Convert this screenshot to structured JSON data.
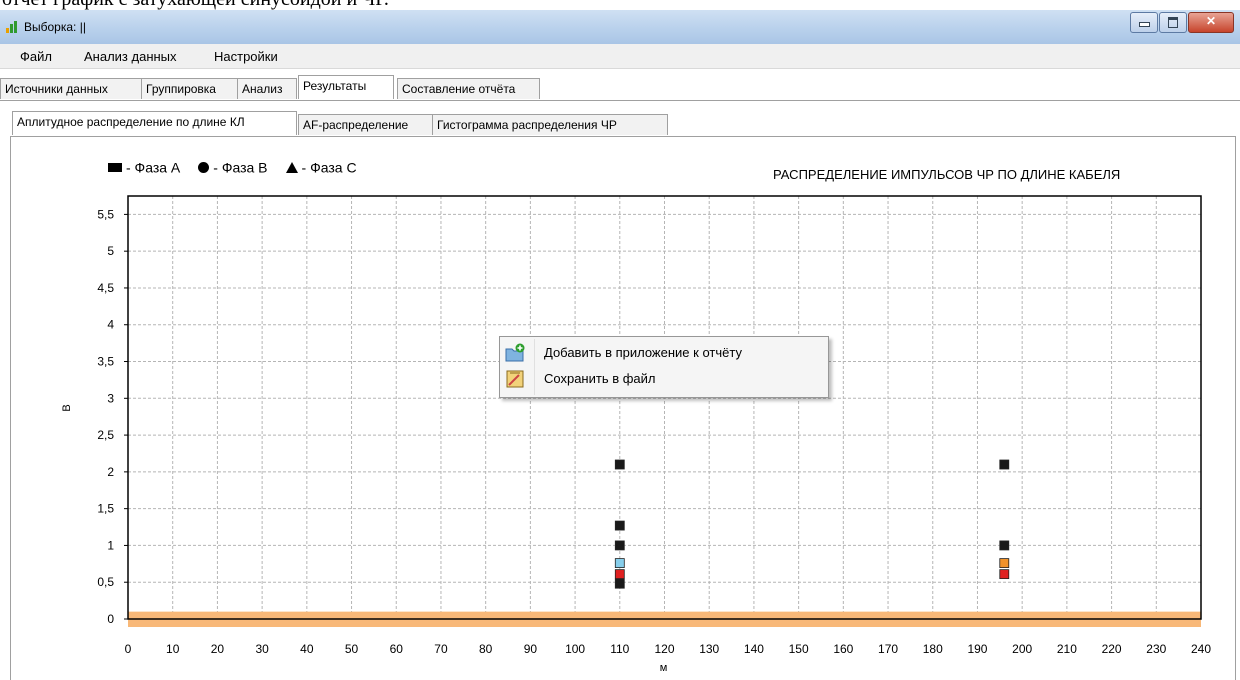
{
  "document_fragment": "отчет график с затухающей синусоидой и ЧР.",
  "window": {
    "title": "Выборка: ||"
  },
  "menu": [
    "Файл",
    "Анализ данных",
    "Настройки"
  ],
  "main_tabs": [
    {
      "label": "Источники данных",
      "active": false
    },
    {
      "label": "Группировка",
      "active": false
    },
    {
      "label": "Анализ",
      "active": false
    },
    {
      "label": "Результаты",
      "active": true
    },
    {
      "label": "Составление отчёта",
      "active": false
    }
  ],
  "sub_tabs": [
    {
      "label": "Аплитудное распределение по длине КЛ",
      "active": true
    },
    {
      "label": "AF-распределение",
      "active": false
    },
    {
      "label": "Гистограмма распределения ЧР",
      "active": false
    }
  ],
  "legend": [
    {
      "marker": "square",
      "label": "- Фаза А"
    },
    {
      "marker": "circle",
      "label": "- Фаза В"
    },
    {
      "marker": "triangle",
      "label": "- Фаза С"
    }
  ],
  "context_menu": [
    {
      "label": "Добавить в приложение к отчёту",
      "icon": "folder-add-icon"
    },
    {
      "label": "Сохранить в файл",
      "icon": "save-file-icon"
    }
  ],
  "chart_data": {
    "type": "scatter",
    "title": "РАСПРЕДЕЛЕНИЕ ИМПУЛЬСОВ ЧР ПО ДЛИНЕ КАБЕЛЯ",
    "xlabel": "м",
    "ylabel": "В",
    "xlim": [
      0,
      240
    ],
    "ylim": [
      0,
      5.75
    ],
    "x_ticks": [
      "0",
      "10",
      "20",
      "30",
      "40",
      "50",
      "60",
      "70",
      "80",
      "90",
      "100",
      "110",
      "120",
      "130",
      "140",
      "150",
      "160",
      "170",
      "180",
      "190",
      "200",
      "210",
      "220",
      "230",
      "240"
    ],
    "y_ticks": [
      "0",
      "0,5",
      "1",
      "1,5",
      "2",
      "2,5",
      "3",
      "3,5",
      "4",
      "4,5",
      "5",
      "5,5"
    ],
    "grid": true,
    "baseline_band": {
      "y_max": 0.1,
      "color": "#f8b878"
    },
    "points": [
      {
        "x": 110,
        "y": 2.1,
        "color": "#1a1a1a"
      },
      {
        "x": 110,
        "y": 1.27,
        "color": "#1a1a1a"
      },
      {
        "x": 110,
        "y": 1.0,
        "color": "#1a1a1a"
      },
      {
        "x": 110,
        "y": 0.76,
        "color": "#87ceeb"
      },
      {
        "x": 110,
        "y": 0.61,
        "color": "#e02020"
      },
      {
        "x": 110,
        "y": 0.48,
        "color": "#1a1a1a"
      },
      {
        "x": 196,
        "y": 2.1,
        "color": "#1a1a1a"
      },
      {
        "x": 196,
        "y": 1.0,
        "color": "#1a1a1a"
      },
      {
        "x": 196,
        "y": 0.76,
        "color": "#f0922a"
      },
      {
        "x": 196,
        "y": 0.61,
        "color": "#e02020"
      }
    ]
  }
}
